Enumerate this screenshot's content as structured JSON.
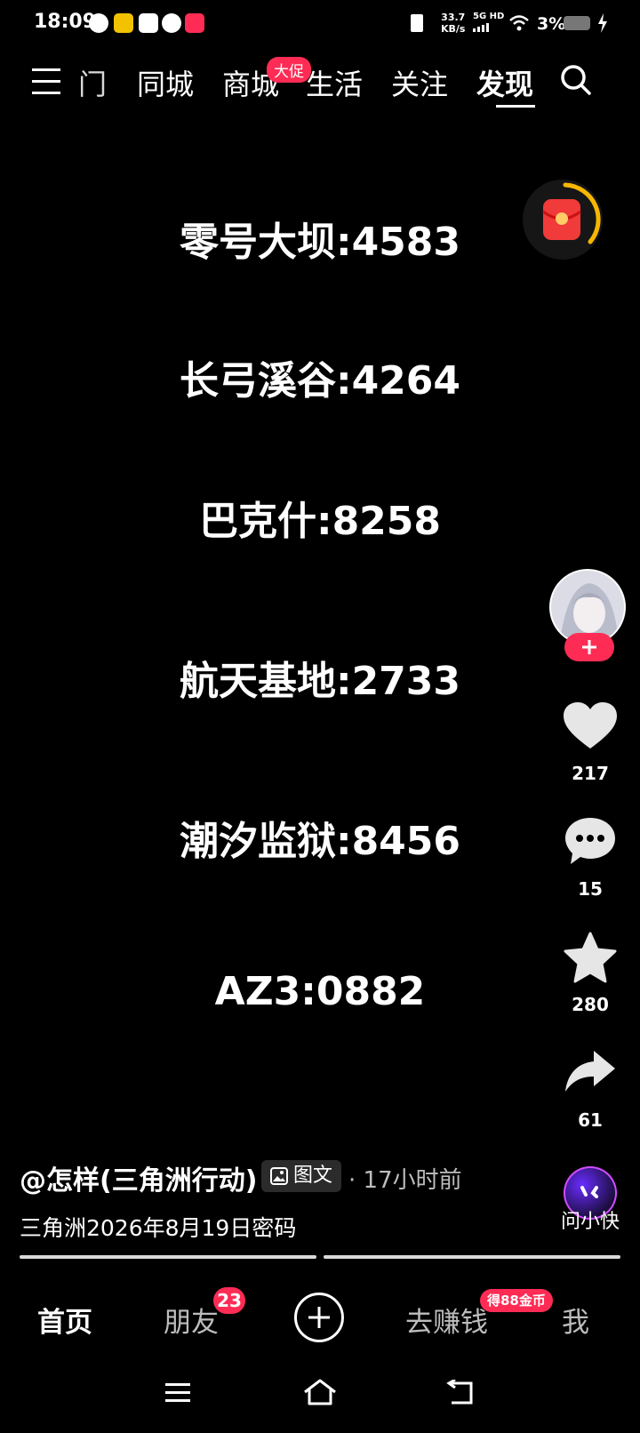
{
  "status_bar": {
    "time": "18:09",
    "net_speed_value": "33.7",
    "net_speed_unit": "KB/s",
    "network": "5G HD",
    "battery": "3%"
  },
  "top_nav": {
    "tabs": [
      "门",
      "同城",
      "商城",
      "生活",
      "关注",
      "发现"
    ],
    "active_tab": "发现",
    "mall_badge": "大促"
  },
  "content": {
    "lines": [
      "零号大坝:4583",
      "长弓溪谷:4264",
      "巴克什:8258",
      "航天基地:2733",
      "潮汐监狱:8456",
      "AZ3:0882"
    ]
  },
  "right_rail": {
    "likes": "217",
    "comments": "15",
    "favorites": "280",
    "shares": "61",
    "assistant_label": "问小快"
  },
  "post": {
    "author": "@怎样(三角洲行动)",
    "type_label": "图文",
    "time_ago": "· 17小时前",
    "caption": "三角洲2026年8月19日密码"
  },
  "bottom_nav": {
    "home": "首页",
    "friends": "朋友",
    "friends_badge": "23",
    "earn": "去赚钱",
    "earn_badge": "得88金币",
    "me": "我"
  },
  "colors": {
    "accent": "#fe2c55",
    "background": "#000000"
  }
}
